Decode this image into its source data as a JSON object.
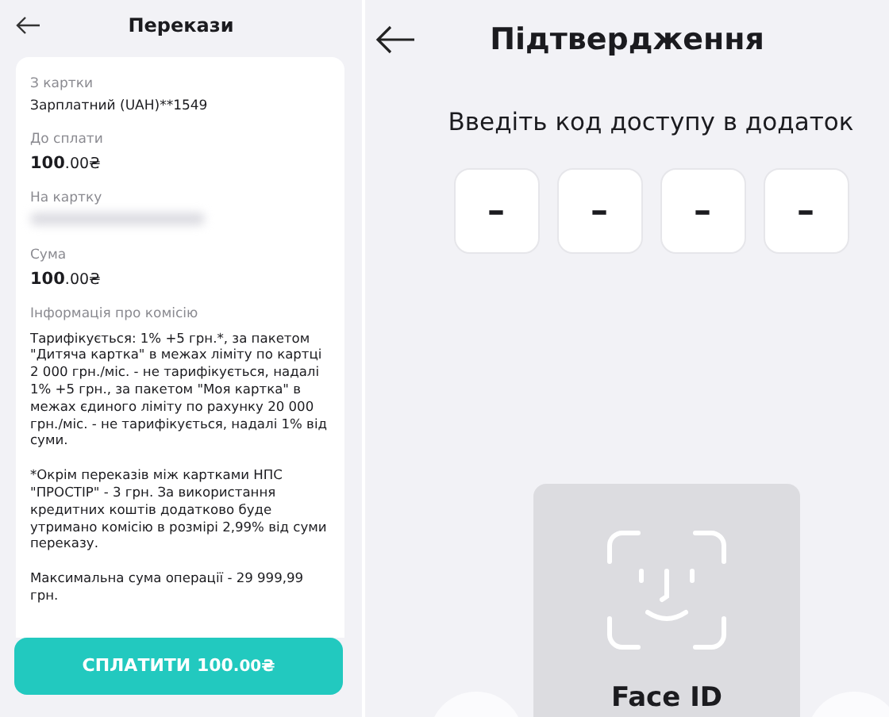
{
  "left": {
    "header": {
      "title": "Перекази"
    },
    "fields": [
      {
        "label": "З картки",
        "value": "Зарплатний (UAH)**1549",
        "kind": "text"
      },
      {
        "label": "До сплати",
        "value": "**100**.00₴",
        "kind": "amount"
      },
      {
        "label": "На картку",
        "kind": "redacted"
      },
      {
        "label": "Сума",
        "value": "**100**.00₴",
        "kind": "amount"
      }
    ],
    "commission": {
      "title": "Інформація про комісію",
      "paragraphs": [
        "Тарифікується: 1% +5 грн.*, за пакетом \"Дитяча картка\" в межах ліміту по картці 2 000 грн./міс. - не тарифікується, надалі  1% +5 грн., за пакетом \"Моя картка\" в межах єдиного ліміту по рахунку 20 000 грн./міс. - не тарифікується, надалі  1% від суми.",
        "*Окрім переказів між картками НПС \"ПРОСТІР\" - 3 грн. За використання кредитних коштів додатково буде утримано комісію в розмірі 2,99% від суми переказу.",
        "Максимальна сума операції - 29 999,99 грн."
      ]
    },
    "pay_button": "**СПЛАТИТИ 100**.00₴"
  },
  "right": {
    "header": {
      "title": "Підтвердження"
    },
    "prompt": "Введіть код доступу в додаток",
    "code_cells": [
      "–",
      "–",
      "–",
      "–"
    ],
    "face_id": {
      "label": "Face ID"
    }
  }
}
